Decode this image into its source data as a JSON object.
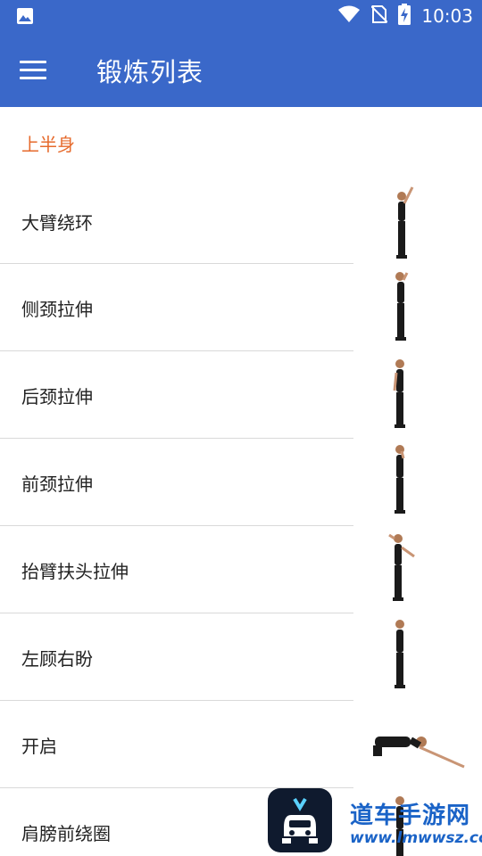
{
  "status": {
    "time": "10:03"
  },
  "appbar": {
    "title": "锻炼列表"
  },
  "section": {
    "title": "上半身"
  },
  "exercises": [
    {
      "label": "大臂绕环"
    },
    {
      "label": "侧颈拉伸"
    },
    {
      "label": "后颈拉伸"
    },
    {
      "label": "前颈拉伸"
    },
    {
      "label": "抬臂扶头拉伸"
    },
    {
      "label": "左顾右盼"
    },
    {
      "label": "开启"
    },
    {
      "label": "肩膀前绕圈"
    }
  ],
  "watermark": {
    "brand": "道车手游网",
    "url": "www.lmwwsz.com"
  }
}
